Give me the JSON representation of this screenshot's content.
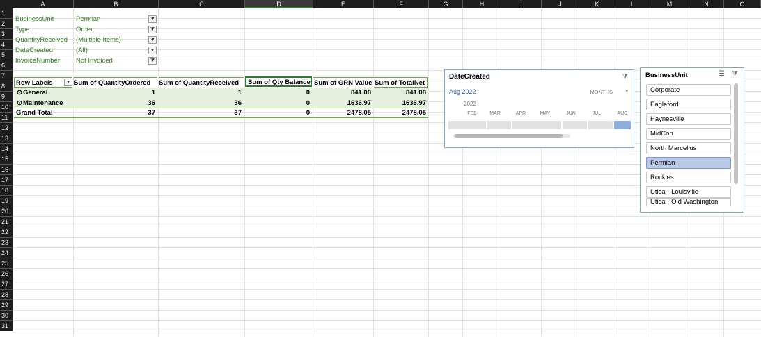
{
  "columns": [
    "A",
    "B",
    "C",
    "D",
    "E",
    "F",
    "G",
    "H",
    "I",
    "J",
    "K",
    "L",
    "M",
    "N",
    "O"
  ],
  "rows": [
    "1",
    "2",
    "3",
    "4",
    "5",
    "6",
    "7",
    "8",
    "9",
    "10",
    "11",
    "12",
    "13",
    "14",
    "15",
    "16",
    "17",
    "18",
    "19",
    "20",
    "21",
    "22",
    "23",
    "24",
    "25",
    "26",
    "27",
    "28",
    "29",
    "30",
    "31"
  ],
  "filters": [
    {
      "field": "BusinessUnit",
      "value": "Permian"
    },
    {
      "field": "Type",
      "value": "Order"
    },
    {
      "field": "QuantityReceived",
      "value": "(Multiple Items)"
    },
    {
      "field": "DateCreated",
      "value": "(All)"
    },
    {
      "field": "InvoiceNumber",
      "value": "Not Invoiced"
    }
  ],
  "pivot": {
    "headers": [
      "Row Labels",
      "Sum of QuantityOrdered",
      "Sum of QuantityReceived",
      "Sum of Qty Balance",
      "Sum of GRN Value",
      "Sum of TotalNet"
    ],
    "rows": [
      {
        "label": "General",
        "values": [
          "1",
          "1",
          "0",
          "841.08",
          "841.08"
        ]
      },
      {
        "label": "Maintenance",
        "values": [
          "36",
          "36",
          "0",
          "1636.97",
          "1636.97"
        ]
      }
    ],
    "total": {
      "label": "Grand Total",
      "values": [
        "37",
        "37",
        "0",
        "2478.05",
        "2478.05"
      ]
    }
  },
  "timeline": {
    "title": "DateCreated",
    "selected": "Aug 2022",
    "level": "MONTHS",
    "year": "2022",
    "months": [
      "FEB",
      "MAR",
      "APR",
      "MAY",
      "JUN",
      "JUL",
      "AUG"
    ]
  },
  "business_unit_slicer": {
    "title": "BusinessUnit",
    "items": [
      "Corporate",
      "Eagleford",
      "Haynesville",
      "MidCon",
      "North Marcellus",
      "Permian",
      "Rockies",
      "Utica - Louisville",
      "Utica - Old Washington"
    ],
    "selected": "Permian"
  },
  "colors": {
    "header_bg": "#1e1e1e",
    "pivot_row_bg": "#e5f0de",
    "pivot_border": "#6aa84f",
    "selected_item": "#b8c8e6",
    "link_blue": "#2b5fb3"
  }
}
